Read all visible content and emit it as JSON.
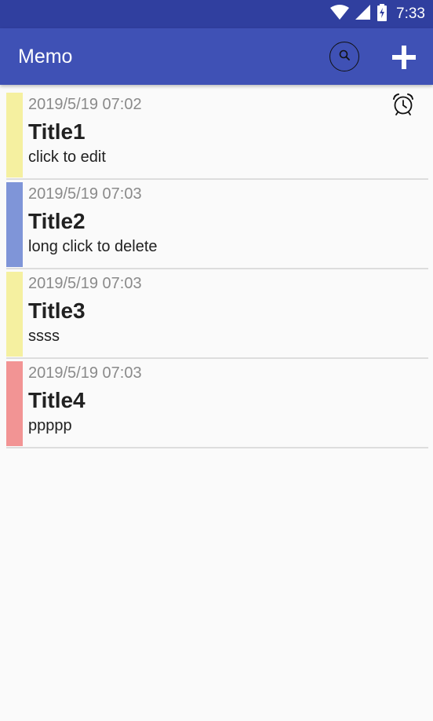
{
  "status_bar": {
    "time": "7:33",
    "icons": [
      "wifi-icon",
      "cell-signal-icon",
      "battery-charging-icon"
    ]
  },
  "app_bar": {
    "title": "Memo",
    "actions": [
      "search-icon",
      "add-icon"
    ]
  },
  "colors": {
    "status_bar": "#303f9f",
    "app_bar": "#3f51b5",
    "yellow": "#f5f0a0",
    "blue": "#7f95d8",
    "red": "#f29494"
  },
  "memos": [
    {
      "date": "2019/5/19 07:02",
      "title": "Title1",
      "body": "click to edit",
      "color": "#f5f0a0",
      "has_alarm": true
    },
    {
      "date": "2019/5/19 07:03",
      "title": "Title2",
      "body": "long click to delete",
      "color": "#7f95d8",
      "has_alarm": false
    },
    {
      "date": "2019/5/19 07:03",
      "title": "Title3",
      "body": "ssss",
      "color": "#f5f0a0",
      "has_alarm": false
    },
    {
      "date": "2019/5/19 07:03",
      "title": "Title4",
      "body": "ppppp",
      "color": "#f29494",
      "has_alarm": false
    }
  ]
}
